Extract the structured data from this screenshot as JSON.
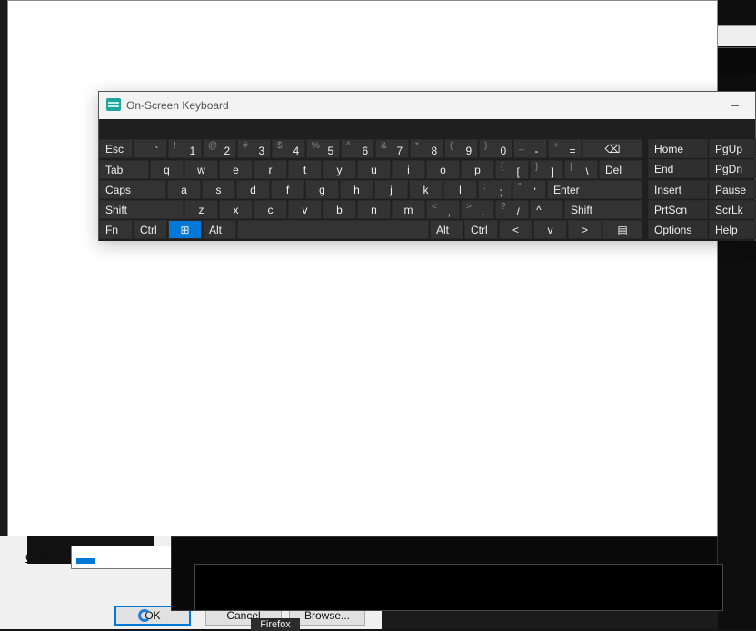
{
  "window_title": "On-Screen Keyboard",
  "minimize_glyph": "–",
  "run_dialog": {
    "open_label": "Open:",
    "ok_label": "OK",
    "cancel_label": "Cancel",
    "browse_label": "Browse..."
  },
  "taskbar_tooltip": "Firefox",
  "keyboard": {
    "row1": [
      {
        "p": "Esc"
      },
      {
        "s": "~",
        "p": "`"
      },
      {
        "s": "!",
        "p": "1"
      },
      {
        "s": "@",
        "p": "2"
      },
      {
        "s": "#",
        "p": "3"
      },
      {
        "s": "$",
        "p": "4"
      },
      {
        "s": "%",
        "p": "5"
      },
      {
        "s": "^",
        "p": "6"
      },
      {
        "s": "&",
        "p": "7"
      },
      {
        "s": "*",
        "p": "8"
      },
      {
        "s": "(",
        "p": "9"
      },
      {
        "s": ")",
        "p": "0"
      },
      {
        "s": "_",
        "p": "-"
      },
      {
        "s": "+",
        "p": "="
      },
      {
        "p": "⌫"
      }
    ],
    "row2": [
      {
        "p": "Tab"
      },
      {
        "p": "q"
      },
      {
        "p": "w"
      },
      {
        "p": "e"
      },
      {
        "p": "r"
      },
      {
        "p": "t"
      },
      {
        "p": "y"
      },
      {
        "p": "u"
      },
      {
        "p": "i"
      },
      {
        "p": "o"
      },
      {
        "p": "p"
      },
      {
        "s": "{",
        "p": "["
      },
      {
        "s": "}",
        "p": "]"
      },
      {
        "s": "|",
        "p": "\\"
      },
      {
        "p": "Del"
      }
    ],
    "row3": [
      {
        "p": "Caps"
      },
      {
        "p": "a"
      },
      {
        "p": "s"
      },
      {
        "p": "d"
      },
      {
        "p": "f"
      },
      {
        "p": "g"
      },
      {
        "p": "h"
      },
      {
        "p": "j"
      },
      {
        "p": "k"
      },
      {
        "p": "l"
      },
      {
        "s": ":",
        "p": ";"
      },
      {
        "s": "\"",
        "p": "'"
      },
      {
        "p": "Enter"
      }
    ],
    "row4": [
      {
        "p": "Shift"
      },
      {
        "p": "z"
      },
      {
        "p": "x"
      },
      {
        "p": "c"
      },
      {
        "p": "v"
      },
      {
        "p": "b"
      },
      {
        "p": "n"
      },
      {
        "p": "m"
      },
      {
        "s": "<",
        "p": ","
      },
      {
        "s": ">",
        "p": "."
      },
      {
        "s": "?",
        "p": "/"
      },
      {
        "p": "^"
      },
      {
        "p": "Shift"
      }
    ],
    "row5": [
      {
        "p": "Fn"
      },
      {
        "p": "Ctrl"
      },
      {
        "p": "⊞"
      },
      {
        "p": "Alt"
      },
      {
        "p": ""
      },
      {
        "p": "Alt"
      },
      {
        "p": "Ctrl"
      },
      {
        "p": "<"
      },
      {
        "p": "v"
      },
      {
        "p": ">"
      },
      {
        "p": "▤"
      }
    ],
    "nav": [
      [
        "Home",
        "PgUp"
      ],
      [
        "End",
        "PgDn"
      ],
      [
        "Insert",
        "Pause"
      ],
      [
        "PrtScn",
        "ScrLk"
      ],
      [
        "Options",
        "Help"
      ]
    ]
  }
}
